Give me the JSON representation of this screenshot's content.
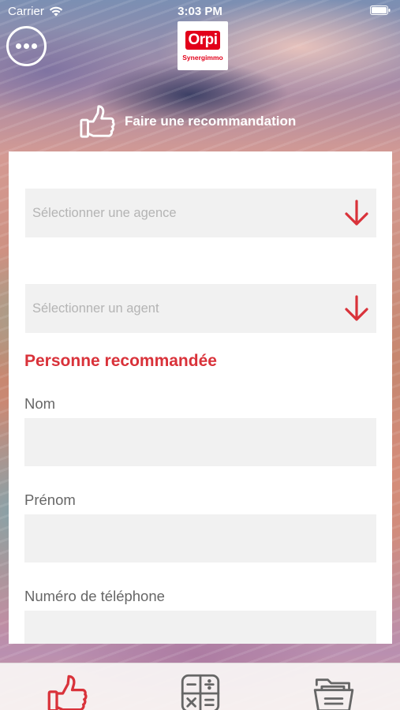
{
  "status_bar": {
    "carrier": "Carrier",
    "time": "3:03 PM"
  },
  "header": {
    "logo_text": "Orpi",
    "logo_subtext": "Synergimmo",
    "menu_icon": "ellipsis-icon"
  },
  "page": {
    "title": "Faire une recommandation",
    "icon": "thumbs-up-icon"
  },
  "form": {
    "agency_select": {
      "placeholder": "Sélectionner une agence"
    },
    "agent_select": {
      "placeholder": "Sélectionner un agent"
    },
    "section_title": "Personne recommandée",
    "fields": [
      {
        "label": "Nom",
        "value": ""
      },
      {
        "label": "Prénom",
        "value": ""
      },
      {
        "label": "Numéro de téléphone",
        "value": ""
      }
    ]
  },
  "tab_bar": {
    "tabs": [
      {
        "icon": "thumbs-up-icon",
        "active": true
      },
      {
        "icon": "calculator-icon",
        "active": false
      },
      {
        "icon": "folder-icon",
        "active": false
      }
    ]
  },
  "colors": {
    "brand": "#e2001a",
    "accent": "#d9323a",
    "inactive_icon": "#666666",
    "field_bg": "#f1f1f1"
  }
}
